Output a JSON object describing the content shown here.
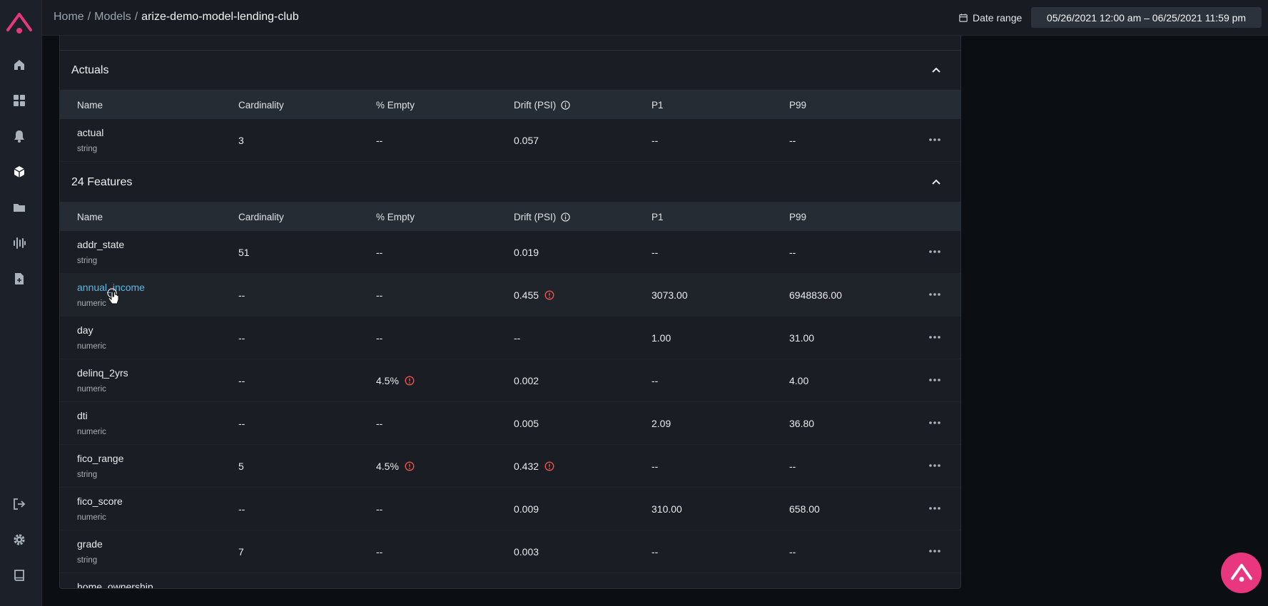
{
  "colors": {
    "accent": "#e8377f",
    "link": "#5ab8e6",
    "warning": "#e8524b"
  },
  "sidebar": {
    "logo_icon": "arize-logo-icon",
    "items": [
      {
        "icon": "home-icon"
      },
      {
        "icon": "dashboard-grid-icon"
      },
      {
        "icon": "bell-icon"
      },
      {
        "icon": "cube-icon"
      },
      {
        "icon": "folder-icon"
      },
      {
        "icon": "waveform-icon"
      },
      {
        "icon": "document-plus-icon"
      }
    ],
    "bottom_items": [
      {
        "icon": "logout-icon"
      },
      {
        "icon": "gear-icon"
      },
      {
        "icon": "book-icon"
      }
    ]
  },
  "header": {
    "breadcrumbs": [
      "Home",
      "Models",
      "arize-demo-model-lending-club"
    ],
    "separator": "/",
    "date_range_label": "Date range",
    "date_range_value": "05/26/2021 12:00 am – 06/25/2021 11:59 pm"
  },
  "columns": [
    "Name",
    "Cardinality",
    "% Empty",
    "Drift (PSI)",
    "P1",
    "P99"
  ],
  "actuals": {
    "title": "Actuals",
    "rows": [
      {
        "name": "actual",
        "type": "string",
        "cardinality": "3",
        "empty": "--",
        "drift": "0.057",
        "p1": "--",
        "p99": "--"
      }
    ]
  },
  "features": {
    "title": "24 Features",
    "rows": [
      {
        "name": "addr_state",
        "type": "string",
        "cardinality": "51",
        "empty": "--",
        "drift": "0.019",
        "p1": "--",
        "p99": "--"
      },
      {
        "name": "annual_income",
        "type": "numeric",
        "cardinality": "--",
        "empty": "--",
        "drift": "0.455",
        "p1": "3073.00",
        "p99": "6948836.00"
      },
      {
        "name": "day",
        "type": "numeric",
        "cardinality": "--",
        "empty": "--",
        "drift": "--",
        "p1": "1.00",
        "p99": "31.00"
      },
      {
        "name": "delinq_2yrs",
        "type": "numeric",
        "cardinality": "--",
        "empty": "4.5%",
        "drift": "0.002",
        "p1": "--",
        "p99": "4.00"
      },
      {
        "name": "dti",
        "type": "numeric",
        "cardinality": "--",
        "empty": "--",
        "drift": "0.005",
        "p1": "2.09",
        "p99": "36.80"
      },
      {
        "name": "fico_range",
        "type": "string",
        "cardinality": "5",
        "empty": "4.5%",
        "drift": "0.432",
        "p1": "--",
        "p99": "--"
      },
      {
        "name": "fico_score",
        "type": "numeric",
        "cardinality": "--",
        "empty": "--",
        "drift": "0.009",
        "p1": "310.00",
        "p99": "658.00"
      },
      {
        "name": "grade",
        "type": "string",
        "cardinality": "7",
        "empty": "--",
        "drift": "0.003",
        "p1": "--",
        "p99": "--"
      },
      {
        "name": "home_ownership",
        "type": "",
        "cardinality": "",
        "empty": "",
        "drift": "",
        "p1": "",
        "p99": ""
      }
    ]
  }
}
